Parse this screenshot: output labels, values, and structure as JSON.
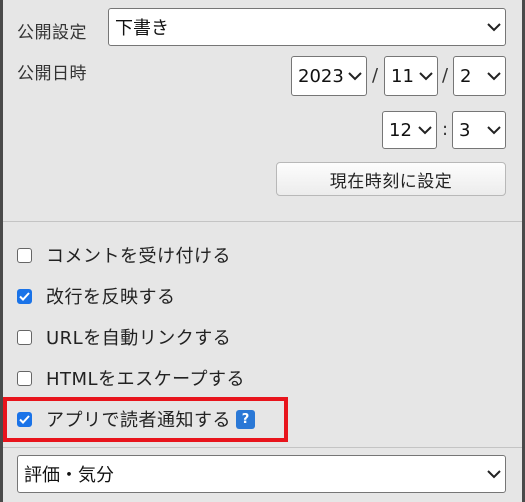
{
  "publish": {
    "setting_label": "公開設定",
    "setting_value": "下書き",
    "datetime_label": "公開日時",
    "year": "2023",
    "month": "11",
    "day": "2",
    "hour": "12",
    "minute": "3",
    "date_sep": "/",
    "time_sep": ":",
    "set_now_label": "現在時刻に設定"
  },
  "options": [
    {
      "label": "コメントを受け付ける",
      "checked": false
    },
    {
      "label": "改行を反映する",
      "checked": true
    },
    {
      "label": "URLを自動リンクする",
      "checked": false
    },
    {
      "label": "HTMLをエスケープする",
      "checked": false
    },
    {
      "label": "アプリで読者通知する",
      "checked": true
    }
  ],
  "help_icon": {
    "glyph": "?",
    "icon": "help-icon"
  },
  "rating": {
    "value": "評価・気分"
  },
  "colors": {
    "highlight": "#e8141c",
    "checkbox_checked": "#1a73e8",
    "help": "#2a78d6"
  }
}
